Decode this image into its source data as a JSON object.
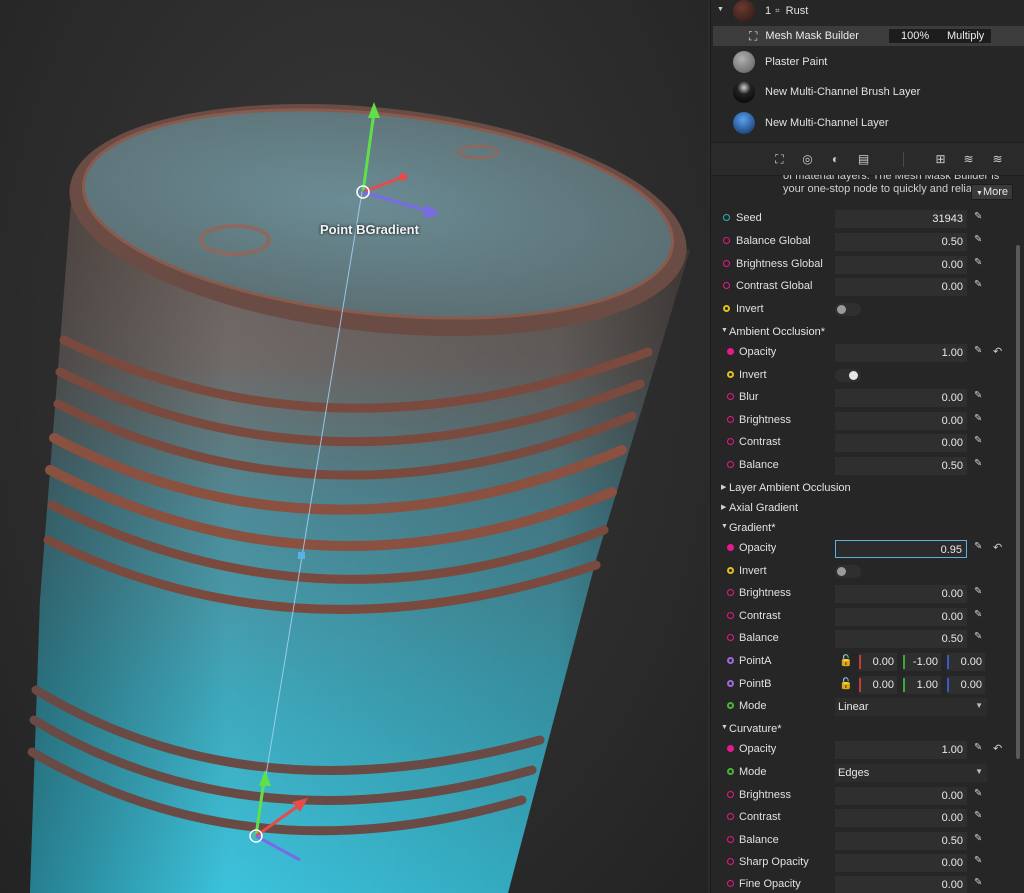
{
  "viewport": {
    "gizmo_label": "Point BGradient"
  },
  "layers": [
    {
      "count": "1",
      "name": "Rust",
      "thumb": "#4a2a22"
    },
    {
      "name": "Plaster Paint",
      "thumb": "#8a8a8a"
    },
    {
      "name": "New Multi-Channel Brush Layer",
      "thumb": "#111111"
    },
    {
      "name": "New Multi-Channel Layer",
      "thumb": "#1c5ea8"
    }
  ],
  "mask": {
    "name": "Mesh Mask Builder",
    "opacity": "100%",
    "blend": "Multiply"
  },
  "toolbar_icons": [
    "crop-icon",
    "globe-icon",
    "contrast-icon",
    "book-icon",
    "add-folder-icon",
    "stack-icon",
    "stack-alt-icon"
  ],
  "description": {
    "line1": "of material layers. The Mesh Mask Builder is",
    "line2": "your one-stop node to quickly and reliab",
    "more": "More"
  },
  "colors": {
    "pink": "#e8198a",
    "yellow": "#e0c31a",
    "teal": "#2ab3b3",
    "purple": "#a06ae0",
    "green": "#4cb33a",
    "accent": "#5bb0e6"
  },
  "global": {
    "seed": {
      "label": "Seed",
      "value": "31943"
    },
    "balance": {
      "label": "Balance Global",
      "value": "0.50"
    },
    "brightness": {
      "label": "Brightness Global",
      "value": "0.00"
    },
    "contrast": {
      "label": "Contrast Global",
      "value": "0.00"
    },
    "invert": {
      "label": "Invert"
    }
  },
  "ao": {
    "title": "Ambient Occlusion*",
    "opacity": {
      "label": "Opacity",
      "value": "1.00"
    },
    "invert": {
      "label": "Invert"
    },
    "blur": {
      "label": "Blur",
      "value": "0.00"
    },
    "brightness": {
      "label": "Brightness",
      "value": "0.00"
    },
    "contrast": {
      "label": "Contrast",
      "value": "0.00"
    },
    "balance": {
      "label": "Balance",
      "value": "0.50"
    }
  },
  "layer_ao": {
    "title": "Layer Ambient Occlusion"
  },
  "axial": {
    "title": "Axial Gradient"
  },
  "gradient": {
    "title": "Gradient*",
    "opacity": {
      "label": "Opacity",
      "value": "0.95"
    },
    "invert": {
      "label": "Invert"
    },
    "brightness": {
      "label": "Brightness",
      "value": "0.00"
    },
    "contrast": {
      "label": "Contrast",
      "value": "0.00"
    },
    "balance": {
      "label": "Balance",
      "value": "0.50"
    },
    "pointA": {
      "label": "PointA",
      "x": "0.00",
      "y": "-1.00",
      "z": "0.00"
    },
    "pointB": {
      "label": "PointB",
      "x": "0.00",
      "y": "1.00",
      "z": "0.00"
    },
    "mode": {
      "label": "Mode",
      "value": "Linear"
    }
  },
  "curvature": {
    "title": "Curvature*",
    "opacity": {
      "label": "Opacity",
      "value": "1.00"
    },
    "mode": {
      "label": "Mode",
      "value": "Edges"
    },
    "brightness": {
      "label": "Brightness",
      "value": "0.00"
    },
    "contrast": {
      "label": "Contrast",
      "value": "0.00"
    },
    "balance": {
      "label": "Balance",
      "value": "0.50"
    },
    "sharp_opacity": {
      "label": "Sharp Opacity",
      "value": "0.00"
    },
    "fine_opacity": {
      "label": "Fine Opacity",
      "value": "0.00"
    }
  }
}
